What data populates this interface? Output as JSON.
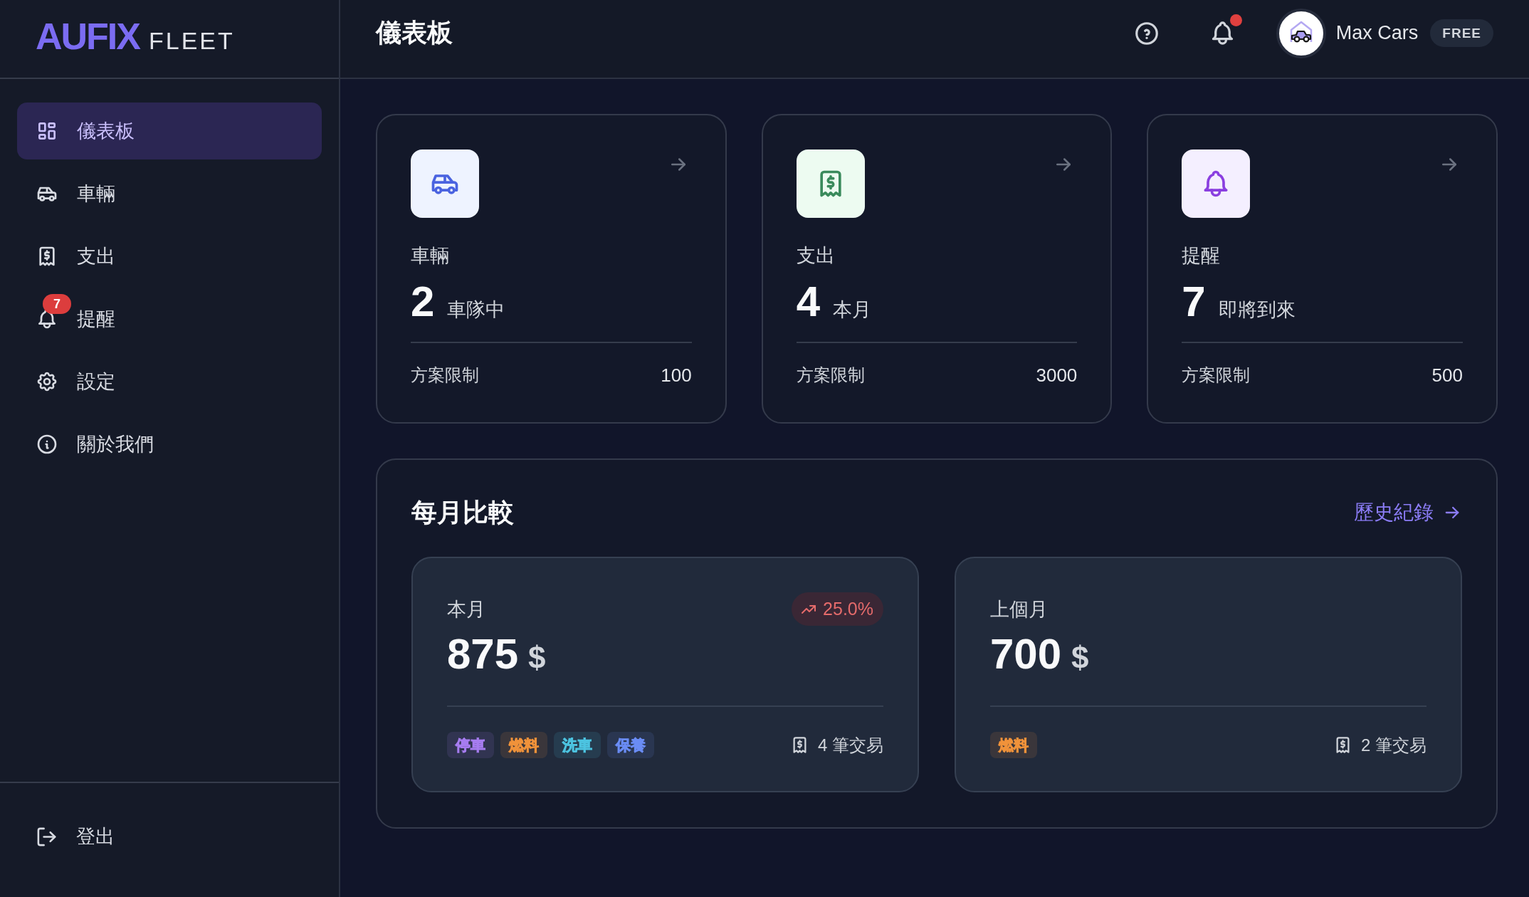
{
  "logo": {
    "wordmark": "AUFIX",
    "product": "FLEET"
  },
  "sidebar": {
    "items": [
      {
        "kind": "dashboard",
        "label": "儀表板",
        "selected": true
      },
      {
        "kind": "vehicles",
        "label": "車輛",
        "selected": false
      },
      {
        "kind": "expenses",
        "label": "支出",
        "selected": false
      },
      {
        "kind": "reminders",
        "label": "提醒",
        "selected": false,
        "badge": "7"
      },
      {
        "kind": "settings",
        "label": "設定",
        "selected": false
      },
      {
        "kind": "about",
        "label": "關於我們",
        "selected": false
      }
    ],
    "logout": {
      "label": "登出"
    }
  },
  "header": {
    "title": "儀表板",
    "has_unread_notifications": true,
    "user": {
      "name": "Max Cars",
      "plan": "FREE"
    }
  },
  "stat_cards": [
    {
      "kind": "vehicles",
      "label": "車輛",
      "value": "2",
      "caption": "車隊中",
      "limit_label": "方案限制",
      "limit": "100"
    },
    {
      "kind": "expenses",
      "label": "支出",
      "value": "4",
      "caption": "本月",
      "limit_label": "方案限制",
      "limit": "3000"
    },
    {
      "kind": "reminders",
      "label": "提醒",
      "value": "7",
      "caption": "即將到來",
      "limit_label": "方案限制",
      "limit": "500"
    }
  ],
  "monthly_comparison": {
    "title": "每月比較",
    "history_link": "歷史紀錄",
    "periods": [
      {
        "label": "本月",
        "amount": "875",
        "currency": "$",
        "change": {
          "text": "25.0%",
          "increase": true
        },
        "tags": [
          {
            "label": "停車",
            "color": "#a67cf0"
          },
          {
            "label": "燃料",
            "color": "#f0923a"
          },
          {
            "label": "洗車",
            "color": "#4cc3e0"
          },
          {
            "label": "保養",
            "color": "#6a8cf5"
          }
        ],
        "transactions": "4 筆交易"
      },
      {
        "label": "上個月",
        "amount": "700",
        "currency": "$",
        "tags": [
          {
            "label": "燃料",
            "color": "#f0923a"
          }
        ],
        "transactions": "2 筆交易"
      }
    ]
  }
}
